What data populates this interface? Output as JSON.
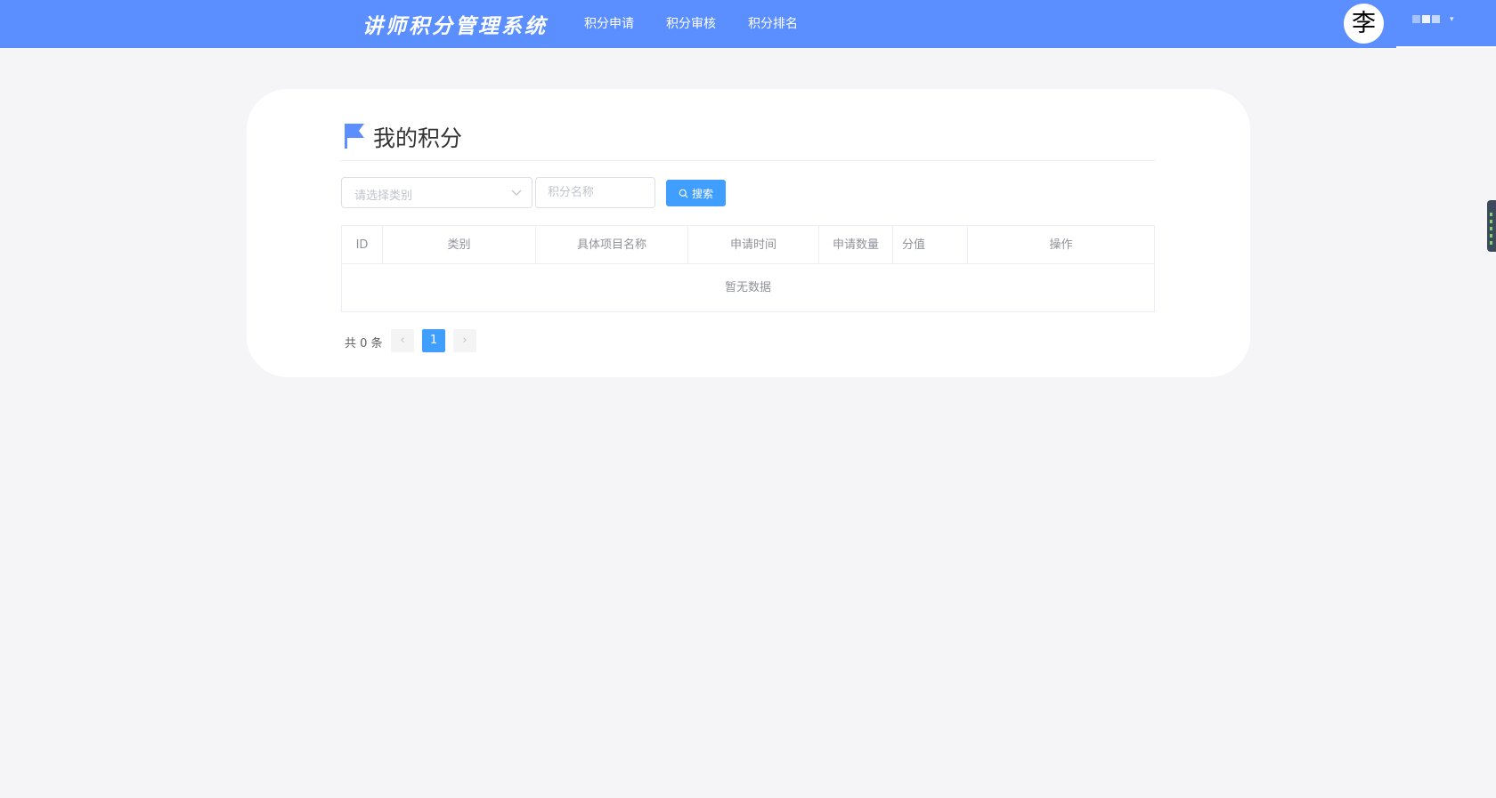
{
  "header": {
    "brand": "讲师积分管理系统",
    "nav": [
      "积分申请",
      "积分审核",
      "积分排名"
    ],
    "avatar_text": "李"
  },
  "page": {
    "title": "我的积分"
  },
  "filters": {
    "category_placeholder": "请选择类别",
    "name_placeholder": "积分名称",
    "search_label": "搜索"
  },
  "table": {
    "columns": [
      "ID",
      "类别",
      "具体项目名称",
      "申请时间",
      "申请数量",
      "分值",
      "操作"
    ],
    "rows": [],
    "empty_text": "暂无数据"
  },
  "pagination": {
    "total_text": "共 0 条",
    "current_page": "1",
    "prev": "‹",
    "next": "›"
  },
  "colors": {
    "header_bg": "#5b8fff",
    "primary": "#409eff",
    "flag": "#5b8fff"
  }
}
